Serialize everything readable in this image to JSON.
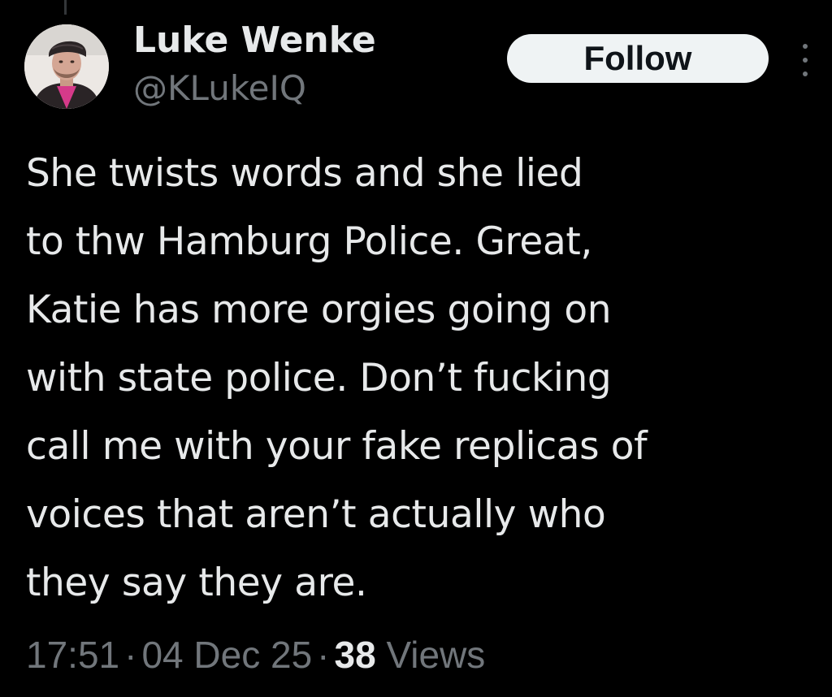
{
  "author": {
    "display_name": "Luke Wenke",
    "handle": "@KLukeIQ",
    "avatar_icon": "profile-photo"
  },
  "actions": {
    "follow_label": "Follow",
    "more_icon": "more-vertical-icon"
  },
  "tweet": {
    "text": "She twists words and she lied\nto thw Hamburg Police.  Great,\nKatie has more orgies going on\nwith state police.  Don’t fucking\ncall me with your fake replicas of\nvoices that aren’t actually who\nthey say they are."
  },
  "meta": {
    "time": "17:51",
    "separator": "·",
    "date": "04 Dec 25",
    "views_count": "38",
    "views_label": "Views"
  },
  "colors": {
    "background": "#000000",
    "primary_text": "#e7e9ea",
    "secondary_text": "#71767b",
    "follow_button_bg": "#eff3f4",
    "follow_button_text": "#0f1419"
  }
}
